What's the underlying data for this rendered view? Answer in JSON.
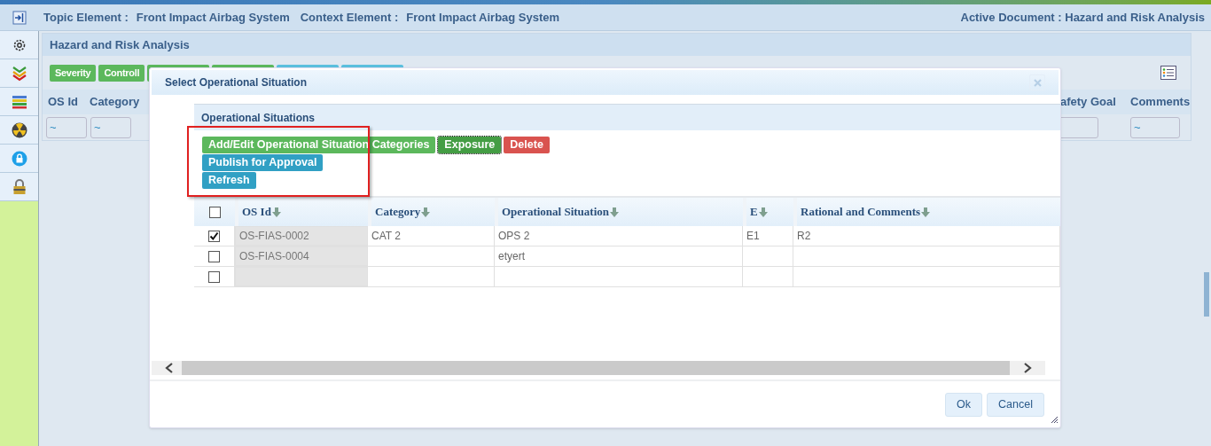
{
  "header": {
    "topic_label": "Topic Element :",
    "topic_value": "Front Impact Airbag System",
    "context_label": "Context Element :",
    "context_value": "Front Impact Airbag System",
    "active_document": "Active Document : Hazard and Risk Analysis"
  },
  "main": {
    "title": "Hazard and Risk Analysis",
    "toolbar": [
      {
        "label": "Severity",
        "color": "#5cb85c"
      },
      {
        "label": "Controll",
        "color": "#5cb85c"
      },
      {
        "color": "#5cb85c"
      },
      {
        "color": "#5cb85c"
      },
      {
        "color": "#5bc0de"
      },
      {
        "color": "#5bc0de"
      }
    ],
    "columns_left": [
      "OS Id",
      "Category"
    ],
    "columns_right": [
      "afety Goal",
      "Comments"
    ],
    "filters_left": [
      "~",
      "~"
    ],
    "filters_right": [
      "~"
    ]
  },
  "dialog": {
    "title": "Select Operational Situation",
    "panel_title": "Operational Situations",
    "buttons": [
      {
        "label": "Add/Edit Operational Situation Categories",
        "color": "#5cb85c",
        "focused": false
      },
      {
        "label": "Exposure",
        "color": "#449d44",
        "focused": true
      },
      {
        "label": "Delete",
        "color": "#d9534f",
        "focused": false
      },
      {
        "label": "Publish for Approval",
        "color": "#31a0c4",
        "focused": false
      },
      {
        "label": "Refresh",
        "color": "#31a0c4",
        "focused": false
      }
    ],
    "header_checked": false,
    "columns": [
      "OS Id",
      "Category",
      "Operational Situation",
      "E",
      "Rational and Comments"
    ],
    "rows": [
      {
        "checked": true,
        "cells": [
          "OS-FIAS-0002",
          "CAT 2",
          "OPS 2",
          "E1",
          "R2"
        ]
      },
      {
        "checked": false,
        "cells": [
          "OS-FIAS-0004",
          "",
          "etyert",
          "",
          ""
        ]
      },
      {
        "checked": false,
        "cells": [
          "",
          "",
          "",
          "",
          ""
        ]
      }
    ],
    "footer_buttons": [
      "Ok",
      "Cancel"
    ]
  }
}
